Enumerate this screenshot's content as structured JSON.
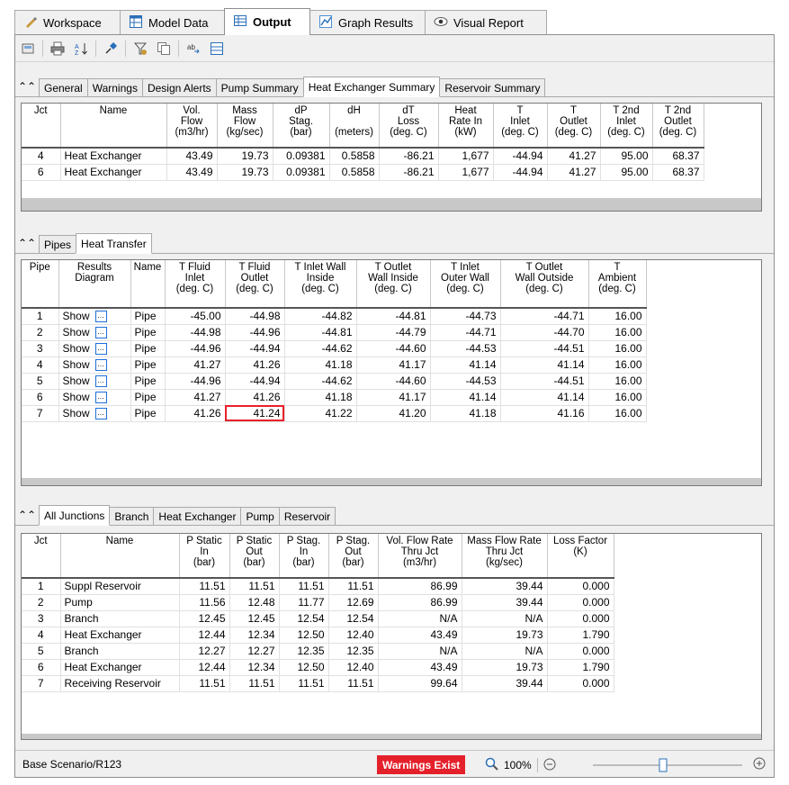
{
  "main_tabs": [
    {
      "label": "Workspace",
      "icon": "pencil-icon"
    },
    {
      "label": "Model Data",
      "icon": "grid-icon"
    },
    {
      "label": "Output",
      "icon": "table-icon"
    },
    {
      "label": "Graph Results",
      "icon": "graph-icon"
    },
    {
      "label": "Visual Report",
      "icon": "eye-icon"
    }
  ],
  "toolbar_icons": [
    "print-preview-icon",
    "print-icon",
    "sort-icon",
    "pin-icon",
    "filter-icon",
    "copy-icon",
    "replace-icon",
    "layout-icon"
  ],
  "hx_panel": {
    "tabs": [
      "General",
      "Warnings",
      "Design Alerts",
      "Pump Summary",
      "Heat Exchanger Summary",
      "Reservoir Summary"
    ],
    "active_tab": "Heat Exchanger Summary",
    "headers": [
      "Jct",
      "Name",
      "Vol.\nFlow\n(m3/hr)",
      "Mass\nFlow\n(kg/sec)",
      "dP\nStag.\n(bar)",
      "dH\n\n(meters)",
      "dT\nLoss\n(deg. C)",
      "Heat\nRate In\n(kW)",
      "T\nInlet\n(deg. C)",
      "T\nOutlet\n(deg. C)",
      "T 2nd\nInlet\n(deg. C)",
      "T 2nd\nOutlet\n(deg. C)"
    ],
    "rows": [
      [
        "4",
        "Heat Exchanger",
        "43.49",
        "19.73",
        "0.09381",
        "0.5858",
        "-86.21",
        "1,677",
        "-44.94",
        "41.27",
        "95.00",
        "68.37"
      ],
      [
        "6",
        "Heat Exchanger",
        "43.49",
        "19.73",
        "0.09381",
        "0.5858",
        "-86.21",
        "1,677",
        "-44.94",
        "41.27",
        "95.00",
        "68.37"
      ]
    ]
  },
  "pipe_panel": {
    "tabs": [
      "Pipes",
      "Heat Transfer"
    ],
    "active_tab": "Heat Transfer",
    "headers": [
      "Pipe",
      "Results\nDiagram",
      "Name",
      "T Fluid\nInlet\n(deg. C)",
      "T Fluid\nOutlet\n(deg. C)",
      "T Inlet Wall\nInside\n(deg. C)",
      "T Outlet\nWall Inside\n(deg. C)",
      "T Inlet\nOuter Wall\n(deg. C)",
      "T Outlet\nWall Outside\n(deg. C)",
      "T\nAmbient\n(deg. C)"
    ],
    "show_label": "Show",
    "dots_label": "...",
    "highlighted_row": 6,
    "rows": [
      [
        "1",
        "Pipe",
        "-45.00",
        "-44.98",
        "-44.82",
        "-44.81",
        "-44.73",
        "-44.71",
        "16.00"
      ],
      [
        "2",
        "Pipe",
        "-44.98",
        "-44.96",
        "-44.81",
        "-44.79",
        "-44.71",
        "-44.70",
        "16.00"
      ],
      [
        "3",
        "Pipe",
        "-44.96",
        "-44.94",
        "-44.62",
        "-44.60",
        "-44.53",
        "-44.51",
        "16.00"
      ],
      [
        "4",
        "Pipe",
        "41.27",
        "41.26",
        "41.18",
        "41.17",
        "41.14",
        "41.14",
        "16.00"
      ],
      [
        "5",
        "Pipe",
        "-44.96",
        "-44.94",
        "-44.62",
        "-44.60",
        "-44.53",
        "-44.51",
        "16.00"
      ],
      [
        "6",
        "Pipe",
        "41.27",
        "41.26",
        "41.18",
        "41.17",
        "41.14",
        "41.14",
        "16.00"
      ],
      [
        "7",
        "Pipe",
        "41.26",
        "41.24",
        "41.22",
        "41.20",
        "41.18",
        "41.16",
        "16.00"
      ]
    ]
  },
  "jct_panel": {
    "tabs": [
      "All Junctions",
      "Branch",
      "Heat Exchanger",
      "Pump",
      "Reservoir"
    ],
    "active_tab": "All Junctions",
    "headers": [
      "Jct",
      "Name",
      "P Static\nIn\n(bar)",
      "P Static\nOut\n(bar)",
      "P Stag.\nIn\n(bar)",
      "P Stag.\nOut\n(bar)",
      "Vol. Flow Rate\nThru Jct\n(m3/hr)",
      "Mass Flow Rate\nThru Jct\n(kg/sec)",
      "Loss Factor\n(K)"
    ],
    "rows": [
      [
        "1",
        "Suppl Reservoir",
        "11.51",
        "11.51",
        "11.51",
        "11.51",
        "86.99",
        "39.44",
        "0.000"
      ],
      [
        "2",
        "Pump",
        "11.56",
        "12.48",
        "11.77",
        "12.69",
        "86.99",
        "39.44",
        "0.000"
      ],
      [
        "3",
        "Branch",
        "12.45",
        "12.45",
        "12.54",
        "12.54",
        "N/A",
        "N/A",
        "0.000"
      ],
      [
        "4",
        "Heat Exchanger",
        "12.44",
        "12.34",
        "12.50",
        "12.40",
        "43.49",
        "19.73",
        "1.790"
      ],
      [
        "5",
        "Branch",
        "12.27",
        "12.27",
        "12.35",
        "12.35",
        "N/A",
        "N/A",
        "0.000"
      ],
      [
        "6",
        "Heat Exchanger",
        "12.44",
        "12.34",
        "12.50",
        "12.40",
        "43.49",
        "19.73",
        "1.790"
      ],
      [
        "7",
        "Receiving Reservoir",
        "11.51",
        "11.51",
        "11.51",
        "11.51",
        "99.64",
        "39.44",
        "0.000"
      ]
    ]
  },
  "status": {
    "scenario": "Base Scenario/R123",
    "warnings": "Warnings Exist",
    "zoom": "100%",
    "zoom_level": 0.5,
    "warning_color": "#e4202a"
  }
}
